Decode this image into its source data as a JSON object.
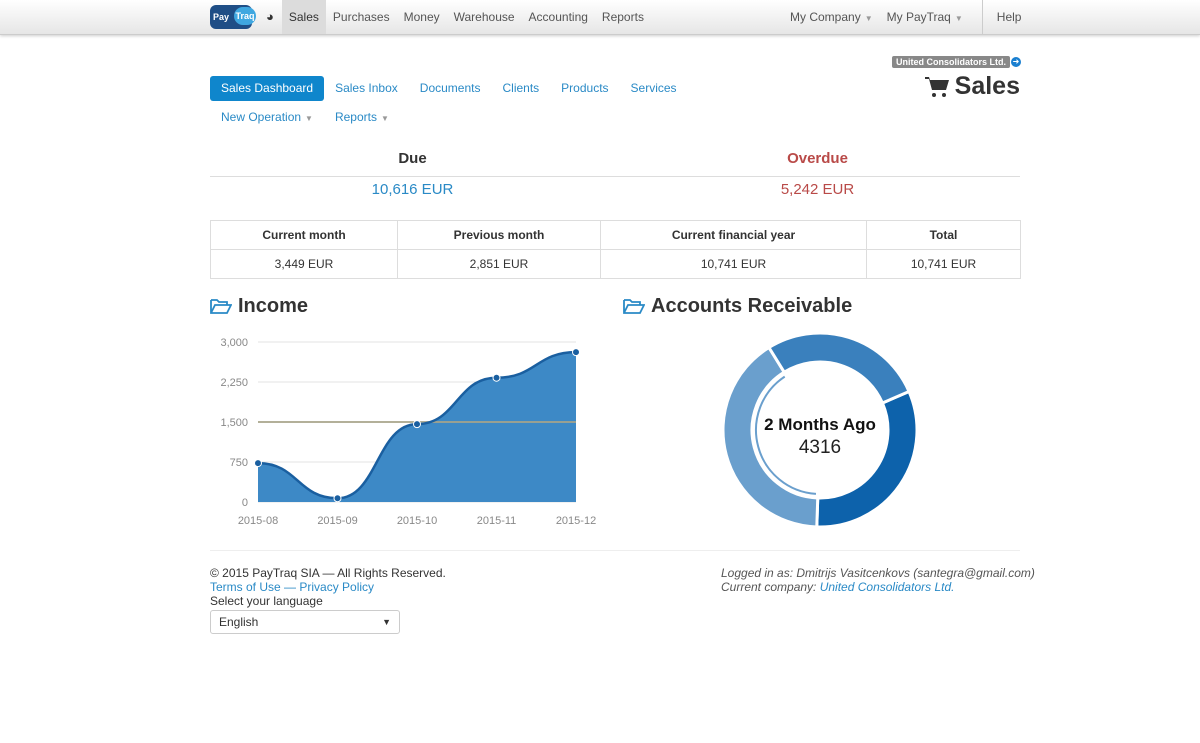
{
  "topnav": {
    "logo": "PayTraq",
    "items": [
      "Sales",
      "Purchases",
      "Money",
      "Warehouse",
      "Accounting",
      "Reports"
    ],
    "active": "Sales",
    "right": [
      "My Company",
      "My PayTraq"
    ],
    "help": "Help"
  },
  "subnav": {
    "items": [
      "Sales Dashboard",
      "Sales Inbox",
      "Documents",
      "Clients",
      "Products",
      "Services",
      "New Operation",
      "Reports"
    ],
    "active": "Sales Dashboard"
  },
  "company_badge": "United Consolidators Ltd.",
  "page_title": "Sales",
  "summary": {
    "due_label": "Due",
    "due_value": "10,616 EUR",
    "overdue_label": "Overdue",
    "overdue_value": "5,242 EUR",
    "colors": {
      "due": "#2a8ac6",
      "overdue": "#b94a48"
    }
  },
  "periods": {
    "headers": [
      "Current month",
      "Previous month",
      "Current financial year",
      "Total"
    ],
    "values": [
      "3,449 EUR",
      "2,851 EUR",
      "10,741 EUR",
      "10,741 EUR"
    ]
  },
  "income_title": "Income",
  "ar_title": "Accounts Receivable",
  "chart_data": [
    {
      "type": "area",
      "categories": [
        "2015-08",
        "2015-09",
        "2015-10",
        "2015-11",
        "2015-12"
      ],
      "values": [
        730,
        70,
        1460,
        2330,
        2810
      ],
      "ylim": [
        0,
        3000
      ],
      "yticks": [
        "0",
        "750",
        "1,500",
        "2,250",
        "3,000"
      ],
      "reference_line": 1500,
      "grid": true,
      "color": "#3d89c6"
    },
    {
      "type": "pie",
      "donut": true,
      "segments": [
        {
          "value": 3400,
          "color": "#0d62ab"
        },
        {
          "value": 4316,
          "label": "2 Months Ago",
          "color": "#6a9fcd"
        },
        {
          "value": 2900,
          "color": "#3a80bd"
        }
      ],
      "center_label": "2 Months Ago",
      "center_value": "4316"
    }
  ],
  "footer": {
    "copyright": "© 2015 PayTraq SIA — All Rights Reserved.",
    "terms": "Terms of Use",
    "dash": " — ",
    "privacy": "Privacy Policy",
    "lang_label": "Select your language",
    "lang_value": "English",
    "logged_in": "Logged in as: Dmitrijs Vasitcenkovs (santegra@gmail.com)",
    "current_company_label": "Current company: ",
    "current_company": "United Consolidators Ltd."
  }
}
